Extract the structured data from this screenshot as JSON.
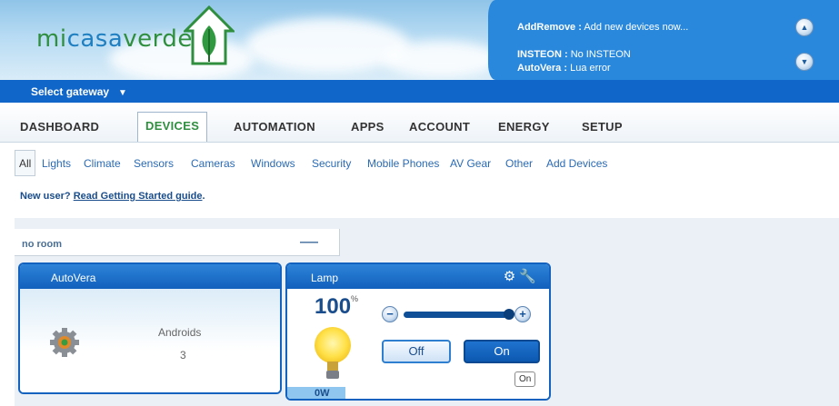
{
  "header": {
    "logo_text_1": "mi",
    "logo_text_2": "casa",
    "logo_text_3": "verde",
    "notices": [
      {
        "title": "AddRemove :",
        "text": "Add new devices now..."
      },
      {
        "title": "INSTEON :",
        "text": "No INSTEON"
      },
      {
        "title": "AutoVera :",
        "text": "Lua error"
      }
    ],
    "scroll_up_icon": "arrow-up-circle",
    "scroll_down_icon": "arrow-down-circle"
  },
  "gateway": {
    "label": "Select gateway"
  },
  "tabs": [
    "DASHBOARD",
    "DEVICES",
    "AUTOMATION",
    "APPS",
    "ACCOUNT",
    "ENERGY",
    "SETUP"
  ],
  "active_tab": "DEVICES",
  "subnav": [
    "All",
    "Lights",
    "Climate",
    "Sensors",
    "Cameras",
    "Windows",
    "Security",
    "Mobile Phones",
    "AV Gear",
    "Other",
    "Add Devices"
  ],
  "active_subnav": "All",
  "newuser": {
    "prefix": "New user?",
    "link": "Read Getting Started guide",
    "suffix": "."
  },
  "room": {
    "name": "no room",
    "collapse_label": "—"
  },
  "devices": [
    {
      "name": "AutoVera",
      "label": "Androids",
      "count": "3"
    },
    {
      "name": "Lamp",
      "level": "100",
      "level_unit": "%",
      "off_label": "Off",
      "on_label": "On",
      "power": "0W",
      "status": "On"
    }
  ],
  "colors": {
    "primary_blue": "#1166c9",
    "brand_green": "#2f8f3f",
    "link_blue": "#2a6ab4"
  }
}
